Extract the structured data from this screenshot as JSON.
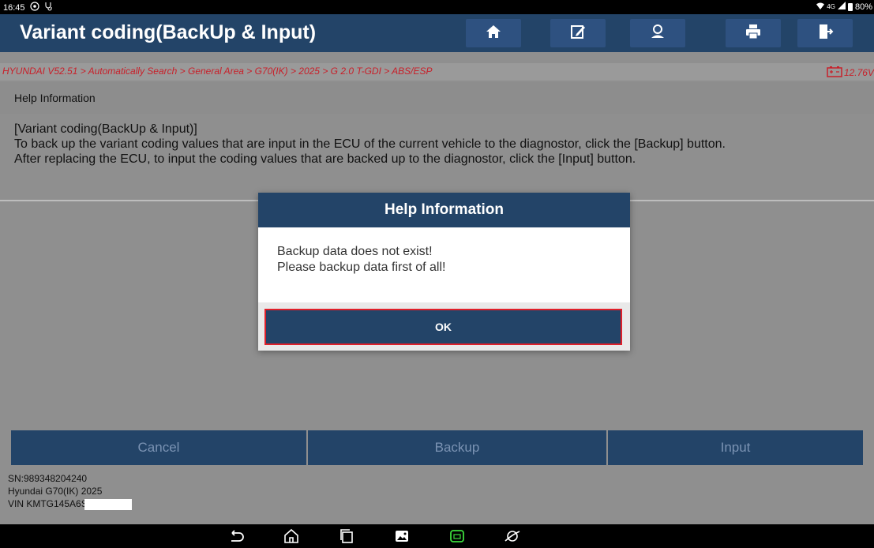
{
  "status_bar": {
    "time": "16:45",
    "left_icons": [
      "settings-gear-icon",
      "stethoscope-icon"
    ],
    "signal": "4G",
    "battery": "80%"
  },
  "title_bar": {
    "title": "Variant coding(BackUp & Input)",
    "buttons": [
      "home-icon",
      "edit-report-icon",
      "user-icon",
      "print-icon",
      "exit-icon"
    ]
  },
  "breadcrumb": {
    "path": "HYUNDAI V52.51 > Automatically Search > General Area > G70(IK) > 2025 > G 2.0 T-GDI > ABS/ESP",
    "voltage": "12.76V"
  },
  "help_section": {
    "header": "Help Information",
    "heading": "[Variant coding(BackUp & Input)]",
    "line1": "To back up the variant coding values that are input in the ECU of the current vehicle to the diagnostor, click the [Backup] button.",
    "line2": "After replacing the ECU, to input the coding values that are backed up to the diagnostor, click the [Input] button."
  },
  "dialog": {
    "title": "Help Information",
    "message_line1": "Backup data does not exist!",
    "message_line2": "Please backup data first of all!",
    "ok_label": "OK"
  },
  "actions": {
    "cancel": "Cancel",
    "backup": "Backup",
    "input": "Input"
  },
  "vehicle_info": {
    "sn": "SN:989348204240",
    "model": "Hyundai G70(IK) 2025",
    "vin": "VIN KMTG145A6S"
  },
  "colors": {
    "title_bar": "#234468",
    "background": "#8f8f8f",
    "breadcrumb_text": "#c8202a",
    "highlight": "#e0202a"
  }
}
